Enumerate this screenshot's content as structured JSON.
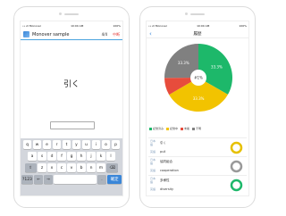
{
  "left_phone": {
    "status": {
      "carrier": "•••ll Monover",
      "time": "10:00 AM",
      "battery": "100%"
    },
    "app_title": "Monover sample",
    "progress": "4/4",
    "action": "中断",
    "question_word": "引く",
    "answer_value": "",
    "keyboard": {
      "row1": [
        "q",
        "w",
        "e",
        "r",
        "t",
        "y",
        "u",
        "i",
        "o",
        "p"
      ],
      "row2": [
        "a",
        "s",
        "d",
        "f",
        "g",
        "h",
        "j",
        "k",
        "l"
      ],
      "row3": [
        "⇧",
        "z",
        "x",
        "c",
        "v",
        "b",
        "n",
        "m",
        "⌫"
      ],
      "row4": [
        "?123",
        "←",
        "→",
        "",
        ".",
        "確定"
      ]
    }
  },
  "right_phone": {
    "status": {
      "carrier": "•••ll Monover",
      "time": "10:00 AM",
      "battery": "100%"
    },
    "title": "履歴",
    "back_icon": "chevron-left-icon",
    "chart_data": {
      "type": "pie",
      "slices": [
        {
          "label": "33.3%",
          "value": 33.3,
          "color": "#1db86a"
        },
        {
          "label": "33.3%",
          "value": 33.3,
          "color": "#f2c300"
        },
        {
          "label": "",
          "value": 8.3,
          "color": "#e74c3c"
        },
        {
          "label": "33.3%",
          "value": 25.1,
          "color": "#808080"
        }
      ],
      "center_label": "#1%",
      "legend": [
        "記憶済み",
        "記憶中",
        "未着",
        "不明"
      ]
    },
    "items": [
      {
        "tag1": "日本語",
        "jp": "引く",
        "tag2": "英語",
        "en": "pull",
        "ring_color": "#e6c000"
      },
      {
        "tag1": "日本語",
        "jp": "協同組合",
        "tag2": "英語",
        "en": "cooperation",
        "ring_color": "#999999"
      },
      {
        "tag1": "日本語",
        "jp": "多様性",
        "tag2": "英語",
        "en": "diversity",
        "ring_color": "#1db86a"
      }
    ]
  }
}
